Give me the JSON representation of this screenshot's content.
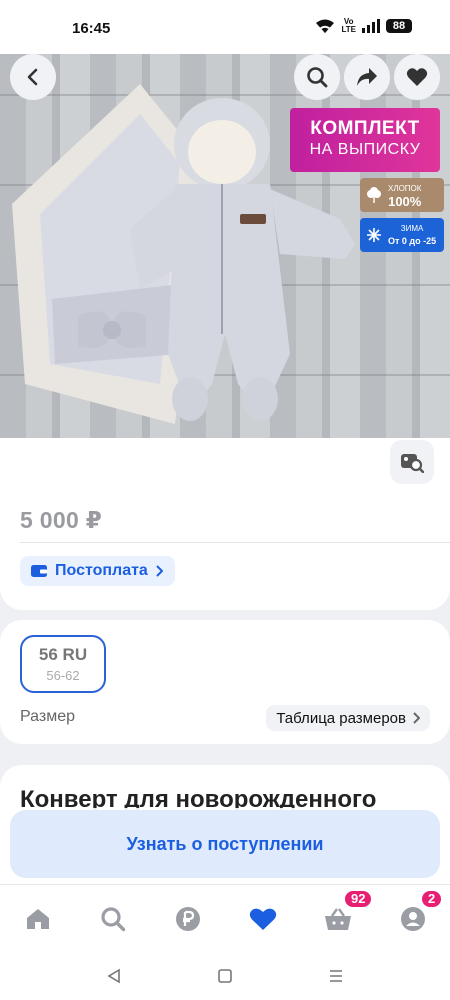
{
  "status_bar": {
    "time": "16:45",
    "volte_top": "Vo",
    "volte_bottom": "LTE",
    "battery": "88"
  },
  "product": {
    "banner_line1": "КОМПЛЕКТ",
    "banner_line2": "НА ВЫПИСКУ",
    "cotton_label": "ХЛОПОК",
    "cotton_value": "100%",
    "winter_label": "ЗИМА",
    "winter_value": "От 0 до -25",
    "price": "5 000 ₽",
    "postpay_label": "Постоплата"
  },
  "size": {
    "selected_ru": "56 RU",
    "selected_range": "56-62",
    "label": "Размер",
    "table_link": "Таблица размеров"
  },
  "title": "Конверт для новорожденного",
  "notify_button": "Узнать о поступлении",
  "bottom_nav": {
    "cart_badge": "92",
    "profile_badge": "2"
  },
  "colors": {
    "accent": "#1b5fe0",
    "badge": "#e81e73",
    "banner": "#c01f9f"
  }
}
